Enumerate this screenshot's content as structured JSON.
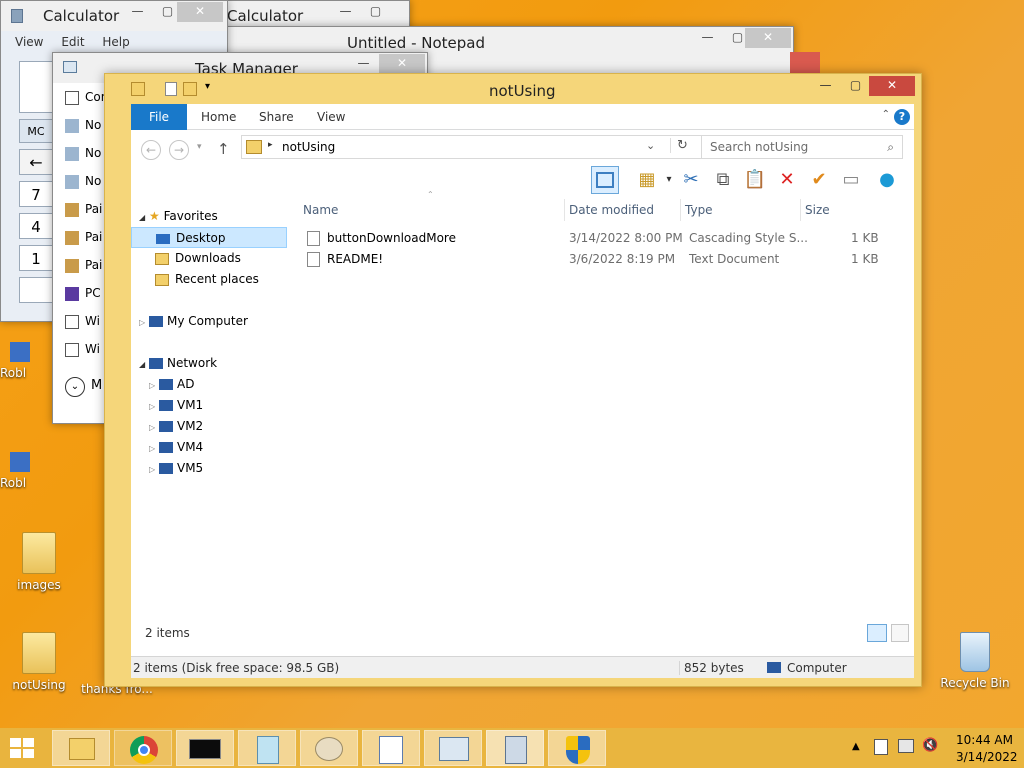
{
  "desktop": {
    "icons": [
      {
        "label": "Robl"
      },
      {
        "label": "Robl"
      },
      {
        "label": "images"
      },
      {
        "label": "notUsing"
      },
      {
        "label": "thanks fro..."
      },
      {
        "label": "Recycle Bin"
      }
    ]
  },
  "calc_back": {
    "title": "Calculator",
    "buttons": {
      "min": "—",
      "max": "▢",
      "close": "✕"
    }
  },
  "calc_front": {
    "title": "Calculator",
    "menu": [
      "View",
      "Edit",
      "Help"
    ],
    "keys": [
      "MC",
      "←",
      "7",
      "4",
      "1"
    ],
    "buttons": {
      "min": "—",
      "max": "▢",
      "close": "✕"
    }
  },
  "notepad": {
    "title": "Untitled - Notepad",
    "buttons": {
      "min": "—",
      "max": "▢",
      "close": "✕"
    }
  },
  "taskmgr": {
    "title": "Task Manager",
    "rows": [
      "Conse",
      "No",
      "No",
      "No",
      "Pai",
      "Pai",
      "Pai",
      "PC",
      "Wi",
      "Wi"
    ],
    "more": "M",
    "buttons": {
      "min": "—",
      "max": "▢",
      "close": "✕"
    }
  },
  "explorer": {
    "title": "notUsing",
    "buttons": {
      "min": "—",
      "max": "▢",
      "close": "✕"
    },
    "ribbon_tabs": [
      "File",
      "Home",
      "Share",
      "View"
    ],
    "address": "notUsing",
    "search_placeholder": "Search notUsing",
    "nav": {
      "favorites": "Favorites",
      "fav_items": [
        "Desktop",
        "Downloads",
        "Recent places"
      ],
      "computer": "My Computer",
      "network": "Network",
      "net_items": [
        "AD",
        "VM1",
        "VM2",
        "VM4",
        "VM5"
      ]
    },
    "columns": [
      "Name",
      "Date modified",
      "Type",
      "Size"
    ],
    "files": [
      {
        "name": "buttonDownloadMore",
        "date": "3/14/2022 8:00 PM",
        "type": "Cascading Style S...",
        "size": "1 KB"
      },
      {
        "name": "README!",
        "date": "3/6/2022 8:19 PM",
        "type": "Text Document",
        "size": "1 KB"
      }
    ],
    "item_count": "2 items",
    "statusbar": {
      "left": "2 items (Disk free space: 98.5 GB)",
      "middle": "852 bytes",
      "right": "Computer"
    }
  },
  "taskbar": {
    "clock_time": "10:44 AM",
    "clock_date": "3/14/2022"
  }
}
